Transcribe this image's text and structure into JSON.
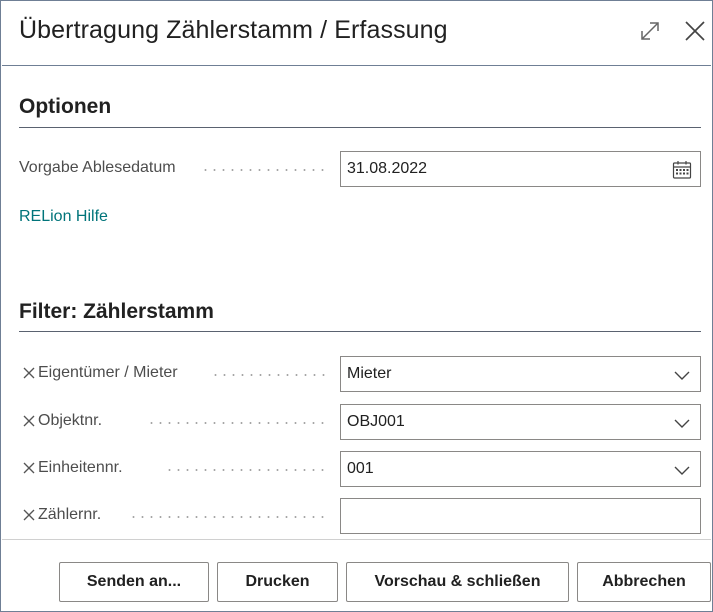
{
  "dialog": {
    "title": "Übertragung Zählerstamm / Erfassung",
    "expand_icon": "expand-icon",
    "close_icon": "close-icon"
  },
  "options": {
    "heading": "Optionen",
    "fields": [
      {
        "label": "Vorgabe Ablesedatum",
        "value": "31.08.2022",
        "icon": "calendar-icon"
      }
    ],
    "help_link": "RELion Hilfe"
  },
  "filter": {
    "heading": "Filter: Zählerstamm",
    "fields": [
      {
        "label": "Eigentümer / Mieter",
        "value": "Mieter",
        "type": "dropdown"
      },
      {
        "label": "Objektnr.",
        "value": "OBJ001",
        "type": "dropdown"
      },
      {
        "label": "Einheitennr.",
        "value": "001",
        "type": "dropdown"
      },
      {
        "label": "Zählernr.",
        "value": "",
        "type": "text"
      }
    ]
  },
  "footer": {
    "buttons": [
      "Senden an...",
      "Drucken",
      "Vorschau & schließen",
      "Abbrechen"
    ]
  },
  "colors": {
    "link": "#00747a",
    "border": "#8a8886",
    "divider": "#6f7f95"
  }
}
